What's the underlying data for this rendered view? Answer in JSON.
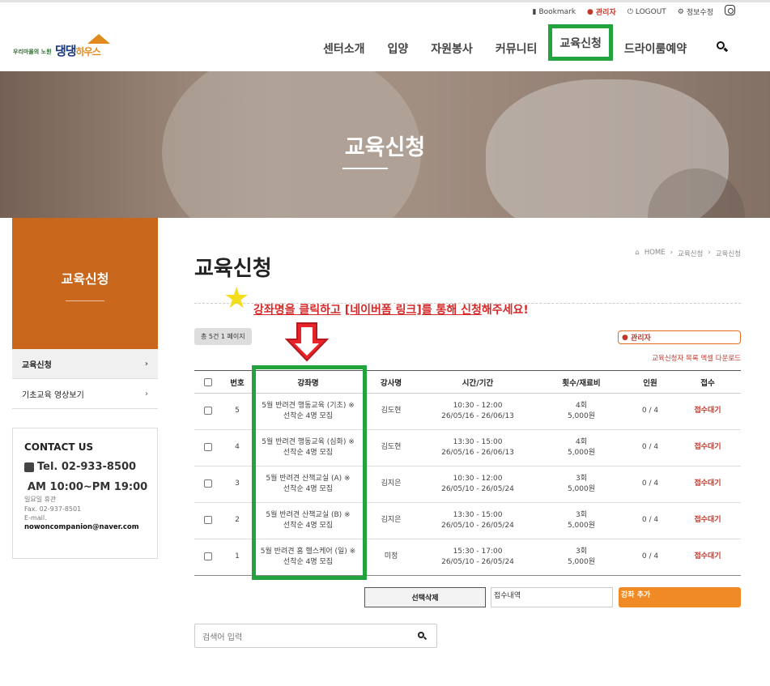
{
  "util": {
    "bookmark": "Bookmark",
    "admin": "관리자",
    "logout": "LOGOUT",
    "profile": "정보수정"
  },
  "logo": {
    "small": "우리마을의 노원",
    "big": "댕댕",
    "big2": "하우스"
  },
  "nav": [
    "센터소개",
    "입양",
    "자원봉사",
    "커뮤니티",
    "교육신청",
    "드라이룸예약"
  ],
  "banner": {
    "title": "교육신청"
  },
  "sidebar": {
    "title": "교육신청",
    "items": [
      {
        "label": "교육신청"
      },
      {
        "label": "기초교육 영상보기"
      }
    ]
  },
  "contact": {
    "heading": "CONTACT US",
    "tel": "Tel. 02-933-8500",
    "hours": "AM 10:00~PM 19:00",
    "holiday": "일요일 휴관",
    "fax": "Fax. 02-937-8501",
    "email_label": "E-mail.",
    "email": "nowoncompanion@naver.com"
  },
  "main": {
    "title": "교육신청",
    "breadcrumb": [
      "HOME",
      "교육신청",
      "교육신청"
    ],
    "notice_a": "강좌명을 클릭하고",
    "notice_b": "[네이버폼 링크]를 통해 신청",
    "notice_c": "해주세요!",
    "count": "총 5건 1 페이지",
    "admin_btn": "관리자",
    "excel": "교육신청자 목록 엑셀 다운로드"
  },
  "table": {
    "headers": [
      "번호",
      "강좌명",
      "강사명",
      "시간/기간",
      "횟수/재료비",
      "인원",
      "접수"
    ],
    "rows": [
      {
        "no": "5",
        "course1": "5월 반려견 행동교육 (기초) ※",
        "course2": "선착순 4명 모집",
        "teacher": "김도현",
        "time1": "10:30 - 12:00",
        "time2": "26/05/16 - 26/06/13",
        "count1": "4회",
        "count2": "5,000원",
        "people": "0 / 4",
        "status": "접수대기"
      },
      {
        "no": "4",
        "course1": "5월 반려견 행동교육 (심화) ※",
        "course2": "선착순 4명 모집",
        "teacher": "김도현",
        "time1": "13:30 - 15:00",
        "time2": "26/05/16 - 26/06/13",
        "count1": "4회",
        "count2": "5,000원",
        "people": "0 / 4",
        "status": "접수대기"
      },
      {
        "no": "3",
        "course1": "5월 반려견 산책교실 (A) ※",
        "course2": "선착순 4명 모집",
        "teacher": "김지은",
        "time1": "10:30 - 12:00",
        "time2": "26/05/10 - 26/05/24",
        "count1": "3회",
        "count2": "5,000원",
        "people": "0 / 4",
        "status": "접수대기"
      },
      {
        "no": "2",
        "course1": "5월 반려견 산책교실 (B) ※",
        "course2": "선착순 4명 모집",
        "teacher": "김지은",
        "time1": "13:30 - 15:00",
        "time2": "26/05/10 - 26/05/24",
        "count1": "3회",
        "count2": "5,000원",
        "people": "0 / 4",
        "status": "접수대기"
      },
      {
        "no": "1",
        "course1": "5월 반려견 홈 헬스케어 (일) ※",
        "course2": "선착순 4명 모집",
        "teacher": "미정",
        "time1": "15:30 - 17:00",
        "time2": "26/05/10 - 26/05/24",
        "count1": "3회",
        "count2": "5,000원",
        "people": "0 / 4",
        "status": "접수대기"
      }
    ]
  },
  "buttons": {
    "delete": "선택삭제",
    "select": "접수내역",
    "add": "강좌 추가"
  },
  "search": {
    "placeholder": "검색어 입력"
  },
  "colors": {
    "accent": "#c9671d",
    "highlight": "#23a33d",
    "alert": "#d42a2a",
    "orange": "#f08a24"
  }
}
